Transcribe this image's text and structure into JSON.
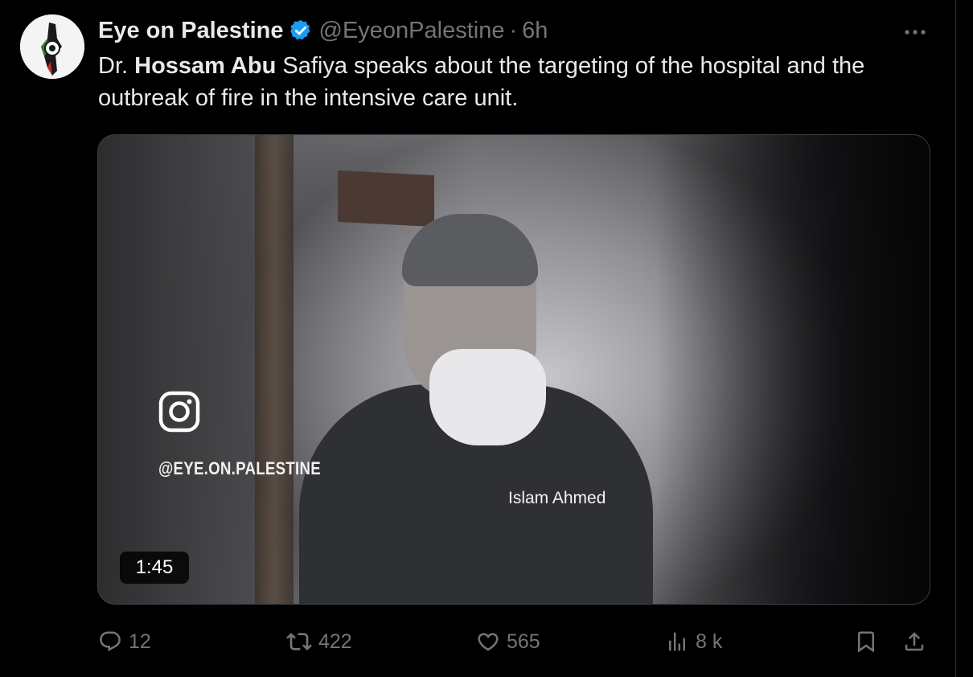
{
  "tweet": {
    "display_name": "Eye on Palestine",
    "handle": "@EyeonPalestine",
    "separator": "·",
    "time": "6h",
    "text_prefix": "Dr. ",
    "text_bold": "Hossam Abu",
    "text_rest": " Safiya speaks about the targeting of the hospital and the outbreak of fire in the intensive care unit."
  },
  "media": {
    "watermark_handle": "@EYE.ON.PALESTINE",
    "credit": "Islam Ahmed",
    "duration": "1:45"
  },
  "actions": {
    "replies": "12",
    "reposts": "422",
    "likes": "565",
    "views": "8 k"
  },
  "colors": {
    "background": "#000000",
    "text_primary": "#e7e9ea",
    "text_secondary": "#71767b",
    "verified_badge": "#1d9bf0"
  },
  "icons": {
    "verified": "verified-badge-icon",
    "more": "more-dots-icon",
    "reply": "reply-icon",
    "repost": "repost-icon",
    "like": "heart-icon",
    "views": "views-chart-icon",
    "bookmark": "bookmark-icon",
    "share": "share-icon",
    "instagram": "instagram-icon"
  }
}
